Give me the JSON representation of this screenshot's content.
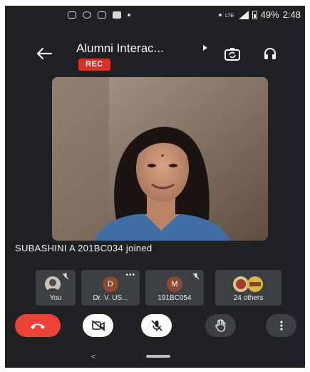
{
  "status_bar": {
    "battery": "49%",
    "time": "2:48"
  },
  "meeting": {
    "title": "Alumni Interac...",
    "recording_badge": "REC"
  },
  "notification": "SUBASHINI A 201BC034 joined",
  "participants": [
    {
      "label": "You",
      "muted": true
    },
    {
      "label": "Dr. V. US...",
      "initial": "D",
      "muted": false
    },
    {
      "label": "191BC054",
      "initial": "M",
      "muted": true
    },
    {
      "label": "24 others"
    }
  ],
  "colors": {
    "background": "#202124",
    "tile": "#3c4043",
    "end_call": "#ea4335",
    "rec": "#d93025",
    "avatar_brown": "#8d4a2f"
  },
  "icons": {
    "back": "arrow-back-icon",
    "switch_camera": "switch-camera-icon",
    "audio": "headphones-icon",
    "end_call": "call-end-icon",
    "camera_off": "videocam-off-icon",
    "mic_off": "mic-off-icon",
    "raise_hand": "hand-icon",
    "more": "more-vert-icon"
  }
}
